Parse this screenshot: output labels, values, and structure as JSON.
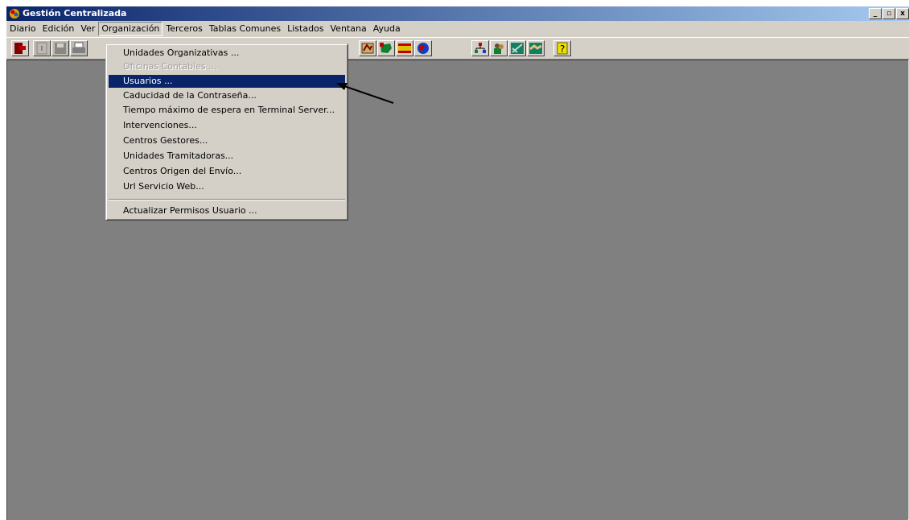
{
  "window": {
    "title": "Gestión Centralizada",
    "buttons": [
      "_",
      "▫",
      "x"
    ]
  },
  "menubar": {
    "items": [
      "Diario",
      "Edición",
      "Ver",
      "Organización",
      "Terceros",
      "Tablas Comunes",
      "Listados",
      "Ventana",
      "Ayuda"
    ],
    "active": "Organización"
  },
  "dropdown": {
    "items": [
      {
        "label": "Unidades Organizativas ...",
        "state": "normal"
      },
      {
        "label": "Oficinas Contables ...",
        "state": "disabled"
      },
      {
        "label": "Usuarios ...",
        "state": "selected"
      },
      {
        "label": "Caducidad de la Contraseña...",
        "state": "normal"
      },
      {
        "label": "Tiempo máximo de espera en Terminal Server...",
        "state": "normal"
      },
      {
        "label": "Intervenciones...",
        "state": "normal"
      },
      {
        "label": "Centros Gestores...",
        "state": "normal"
      },
      {
        "label": "Unidades Tramitadoras...",
        "state": "normal"
      },
      {
        "label": "Centros Origen del Envío...",
        "state": "normal"
      },
      {
        "label": "Url Servicio Web...",
        "state": "normal"
      },
      {
        "label": "Actualizar Permisos Usuario ...",
        "state": "normal"
      }
    ]
  },
  "toolbar": {
    "icons": [
      "exit-icon",
      "open-icon",
      "save-icon",
      "print-icon",
      "map-icon",
      "iberia-map-icon",
      "spain-flag-icon",
      "globe-icon",
      "org-chart-icon",
      "users-icon",
      "tools-icon",
      "handshake-icon",
      "help-icon"
    ]
  },
  "colors": {
    "titlebar_start": "#0a246a",
    "titlebar_end": "#a6caf0",
    "workspace": "#808080",
    "selection": "#0a246a"
  }
}
